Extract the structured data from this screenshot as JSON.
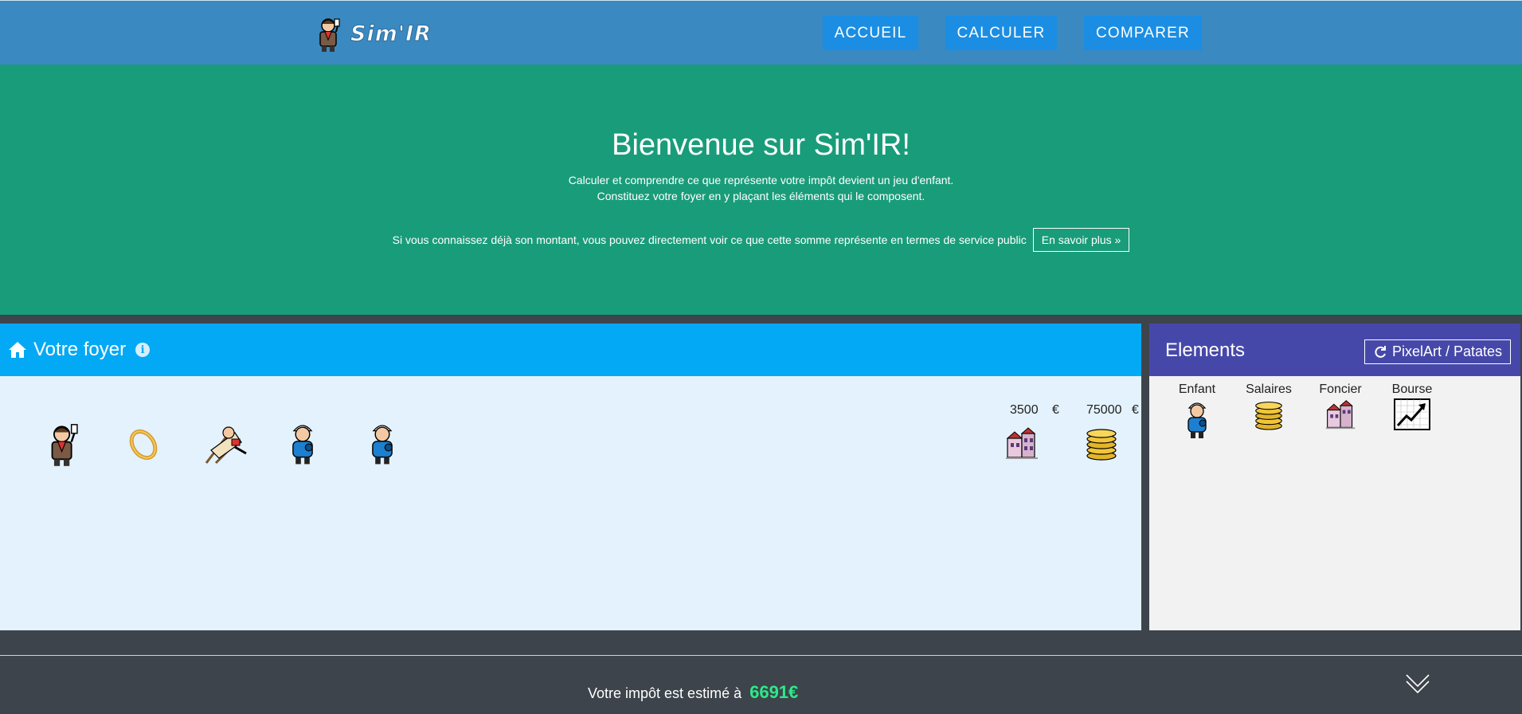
{
  "navbar": {
    "brand": "Sim'IR",
    "links": [
      "ACCUEIL",
      "CALCULER",
      "COMPARER"
    ]
  },
  "hero": {
    "title": "Bienvenue sur Sim'IR!",
    "line1": "Calculer et comprendre ce que représente votre impôt devient un jeu d'enfant.",
    "line2": "Constituez votre foyer en y plaçant les éléments qui le composent.",
    "line3": "Si vous connaissez déjà son montant, vous pouvez directement voir ce que cette somme représente en termes de service public",
    "button": "En savoir plus »"
  },
  "foyer": {
    "title": "Votre foyer",
    "info_icon": "i",
    "amounts": [
      {
        "value": "3500",
        "unit": "€",
        "kind": "foncier"
      },
      {
        "value": "75000",
        "unit": "€",
        "kind": "salaires"
      }
    ],
    "members": [
      "declarant",
      "alliance",
      "retraite",
      "enfant",
      "enfant"
    ]
  },
  "elements": {
    "title": "Elements",
    "switch_label": "PixelArt / Patates",
    "items": [
      "Enfant",
      "Salaires",
      "Foncier",
      "Bourse"
    ]
  },
  "footer": {
    "estimate_label": "Votre impôt est estimé à",
    "estimate_value": "6691€"
  },
  "colors": {
    "navbar": "#3a89c1",
    "hero": "#199c7a",
    "foyer_header": "#03a9f4",
    "elements_header": "#4648a9",
    "estimate": "#2ee88a"
  }
}
